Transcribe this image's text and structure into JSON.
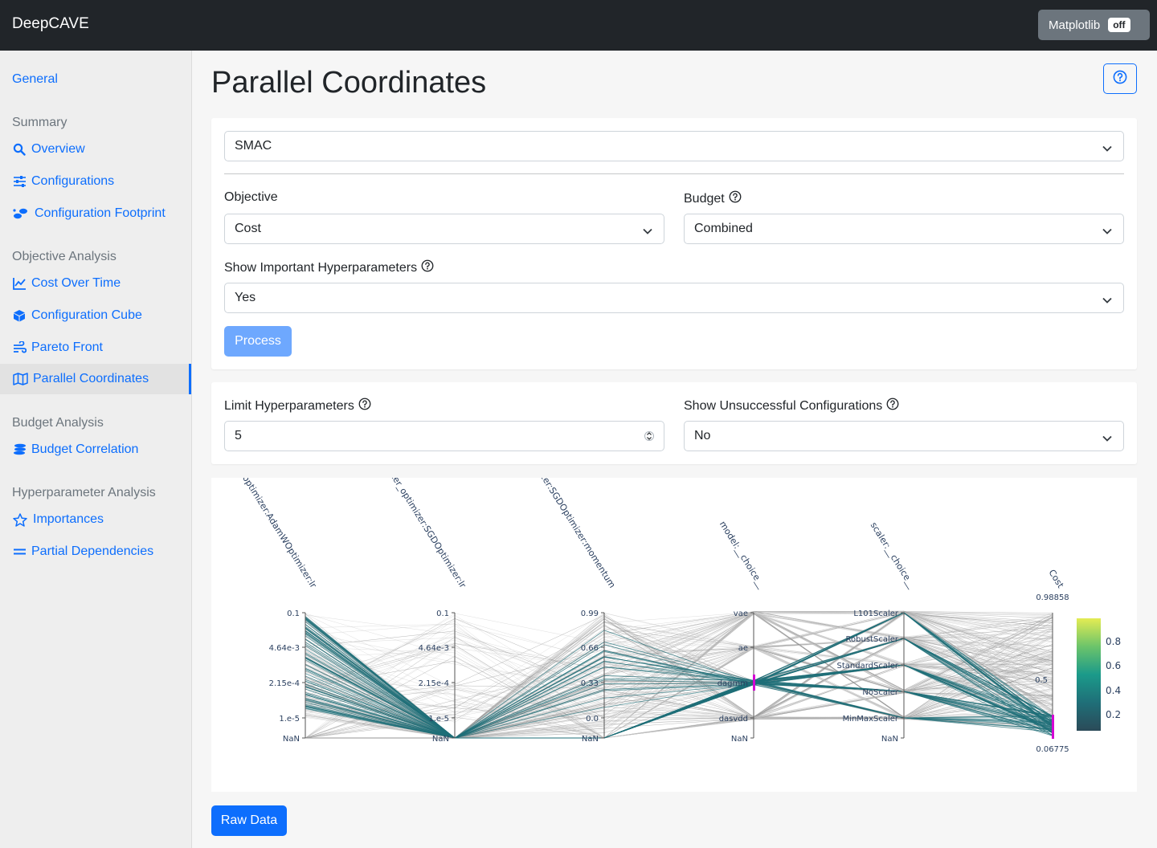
{
  "app": {
    "brand": "DeepCAVE",
    "matplotlib_label": "Matplotlib",
    "matplotlib_state": "off"
  },
  "sidebar": {
    "general": "General",
    "sections": [
      {
        "heading": "Summary",
        "items": [
          {
            "label": "Overview",
            "icon": "search-icon"
          },
          {
            "label": "Configurations",
            "icon": "sliders-icon"
          },
          {
            "label": "Configuration Footprint",
            "icon": "footprints-icon"
          }
        ]
      },
      {
        "heading": "Objective Analysis",
        "items": [
          {
            "label": "Cost Over Time",
            "icon": "line-chart-icon"
          },
          {
            "label": "Configuration Cube",
            "icon": "cube-icon"
          },
          {
            "label": "Pareto Front",
            "icon": "wind-icon"
          },
          {
            "label": "Parallel Coordinates",
            "icon": "map-icon",
            "active": true
          }
        ]
      },
      {
        "heading": "Budget Analysis",
        "items": [
          {
            "label": "Budget Correlation",
            "icon": "coins-icon"
          }
        ]
      },
      {
        "heading": "Hyperparameter Analysis",
        "items": [
          {
            "label": "Importances",
            "icon": "star-icon"
          },
          {
            "label": "Partial Dependencies",
            "icon": "equals-icon"
          }
        ]
      }
    ]
  },
  "page": {
    "title": "Parallel Coordinates"
  },
  "inputs": {
    "run_select": "SMAC",
    "objective_label": "Objective",
    "objective_value": "Cost",
    "budget_label": "Budget",
    "budget_value": "Combined",
    "important_label": "Show Important Hyperparameters",
    "important_value": "Yes",
    "process_label": "Process",
    "limit_label": "Limit Hyperparameters",
    "limit_value": "5",
    "unsuccessful_label": "Show Unsuccessful Configurations",
    "unsuccessful_value": "No"
  },
  "footer": {
    "raw_data_label": "Raw Data"
  },
  "colors": {
    "accent": "#0d6efd",
    "line_highlight": "#1f6f78",
    "line_muted": "#9e9e9e",
    "brush": "#d400d4"
  },
  "chart_data": {
    "type": "parallel_coordinates",
    "dimensions": [
      {
        "label": "optimizer:AdamWOptimizer:lr",
        "ticks": [
          "0.1",
          "4.64e-3",
          "2.15e-4",
          "1.e-5",
          "NaN"
        ]
      },
      {
        "label": "center_optimizer:SGDOptimizer:lr",
        "ticks": [
          "0.1",
          "4.64e-3",
          "2.15e-4",
          "1.e-5",
          "NaN"
        ]
      },
      {
        "label": "optimizer:SGDOptimizer:momentum",
        "ticks": [
          "0.99",
          "0.66",
          "0.33",
          "0.0",
          "NaN"
        ]
      },
      {
        "label": "model:__choice__",
        "ticks": [
          "vae",
          "ae",
          "dagmm",
          "dasvdd",
          "NaN"
        ]
      },
      {
        "label": "scaler:__choice__",
        "ticks": [
          "L101Scaler",
          "RobustScaler",
          "StandardScaler",
          "NoScaler",
          "MinMaxScaler",
          "NaN"
        ]
      },
      {
        "label": "Cost",
        "ticks": [
          "0.98858",
          "0.5",
          "0.06775"
        ],
        "range": [
          0.06775,
          0.98858
        ]
      }
    ],
    "colorbar": {
      "ticks": [
        "0.8",
        "0.6",
        "0.4",
        "0.2"
      ],
      "range": [
        0.06775,
        0.98858
      ],
      "colorscale": "viridis"
    },
    "brushed_selection": {
      "model:__choice__": "dagmm",
      "Cost": [
        0.06775,
        0.13
      ]
    }
  }
}
